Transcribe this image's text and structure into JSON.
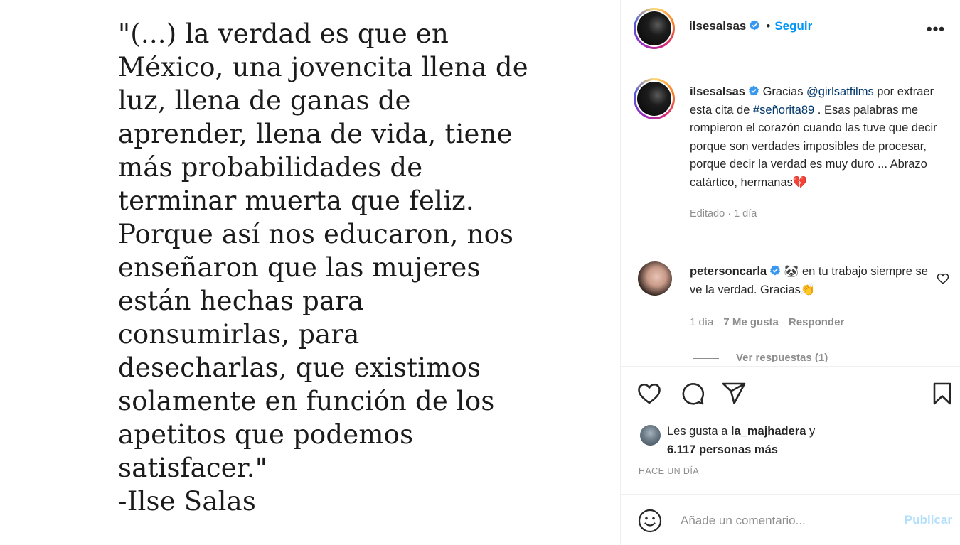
{
  "post_image": {
    "quote_lines": [
      "\"(...) la verdad es que en",
      "México, una jovencita llena de",
      "luz, llena de ganas de",
      "aprender, llena de vida, tiene",
      "más probabilidades de",
      "terminar muerta que feliz.",
      "Porque así nos educaron, nos",
      "enseñaron que las mujeres",
      "están hechas para",
      "consumirlas, para",
      "desecharlas, que existimos",
      "solamente en función de los",
      "apetitos que podemos",
      "satisfacer.\"",
      "-Ilse Salas"
    ]
  },
  "header": {
    "username": "ilsesalsas",
    "separator": "•",
    "follow_label": "Seguir",
    "more_label": "•••"
  },
  "caption": {
    "username": "ilsesalsas",
    "text_before_mention": "Gracias ",
    "mention": "@girlsatfilms",
    "text_after_mention": " por extraer esta cita de ",
    "hashtag": "#señorita89",
    "text_rest": " . Esas palabras me rompieron el corazón cuando las tuve que decir porque son verdades imposibles de procesar, porque decir la verdad es muy duro ... Abrazo catártico, hermanas💔",
    "meta": "Editado · 1 día"
  },
  "comment": {
    "username": "petersoncarla",
    "text": "🐼 en tu trabajo siempre se ve la verdad. Gracias👏",
    "time": "1 día",
    "likes": "7 Me gusta",
    "reply_label": "Responder",
    "view_replies": "Ver respuestas (1)"
  },
  "likes": {
    "prefix": "Les gusta a ",
    "user": "la_majhadera",
    "middle": " y ",
    "count": "6.117 personas más"
  },
  "timestamp": "HACE UN DÍA",
  "add_comment": {
    "placeholder": "Añade un comentario...",
    "publish_label": "Publicar"
  },
  "colors": {
    "accent": "#0095f6",
    "publish_disabled": "#b2dffc",
    "muted": "#8e8e8e"
  }
}
